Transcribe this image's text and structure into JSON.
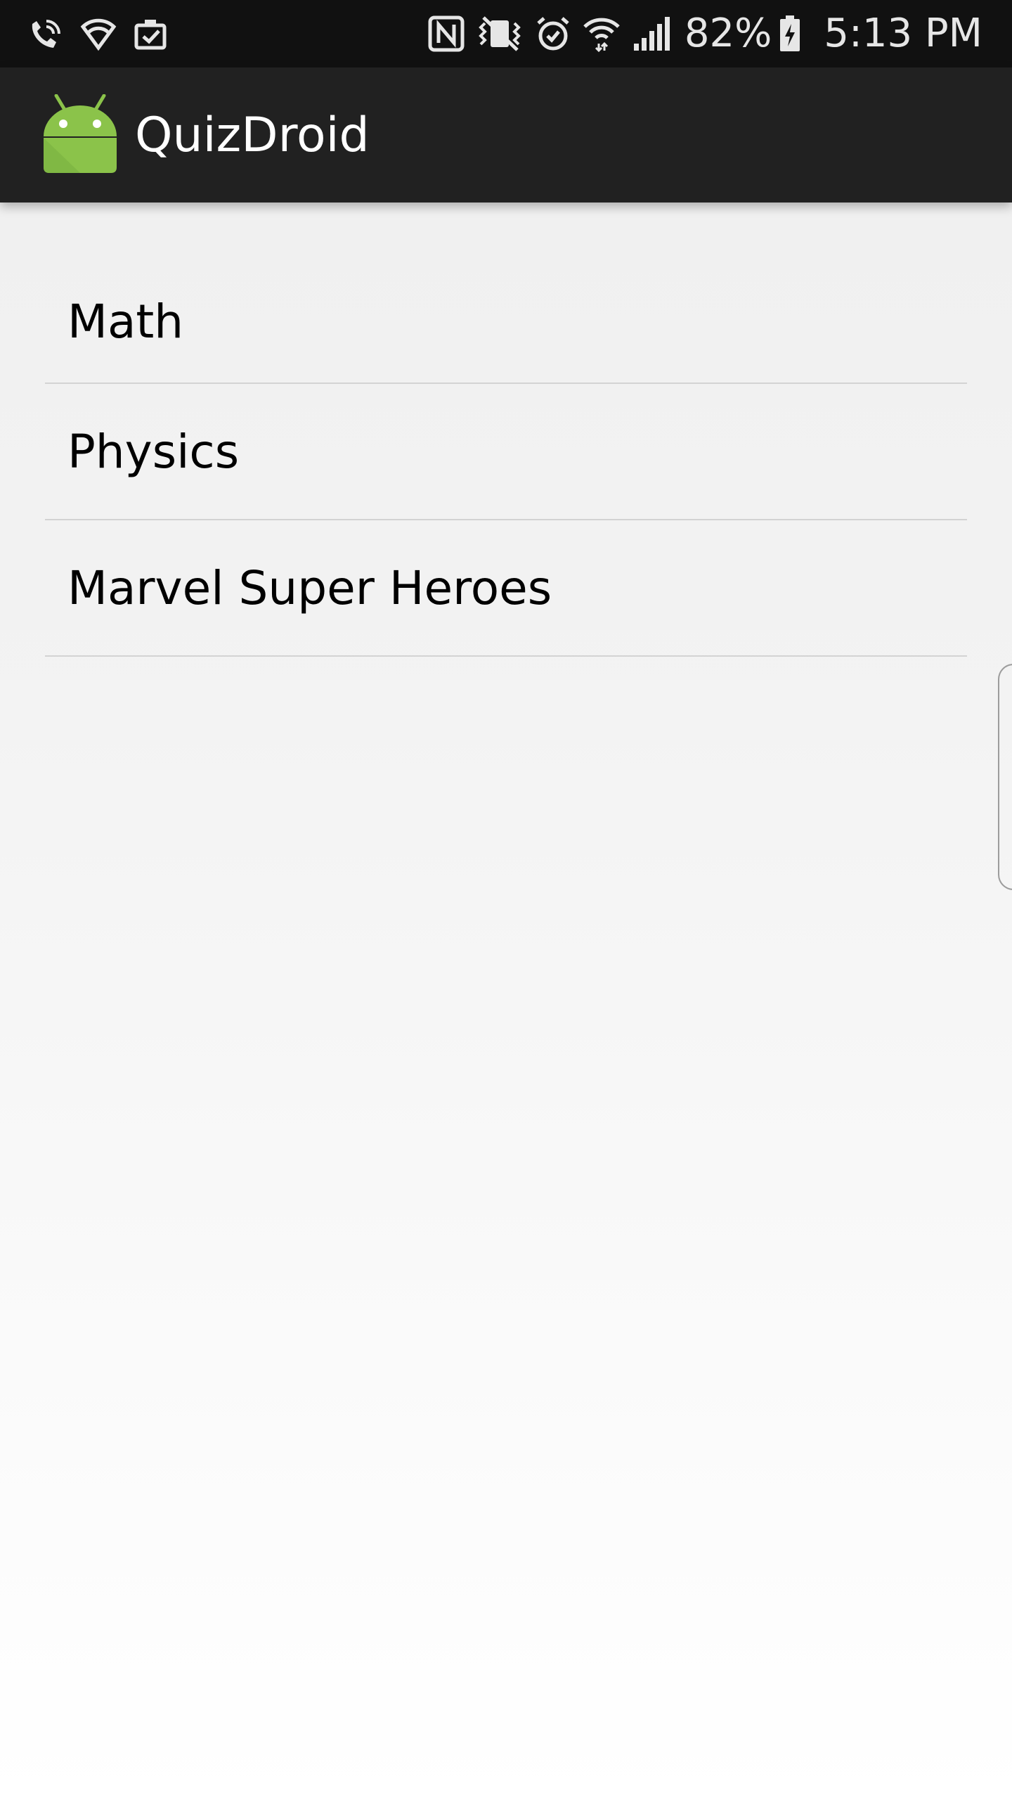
{
  "status_bar": {
    "left_icons": [
      "wifi-calling-icon",
      "wifi-secure-icon",
      "clipboard-check-icon"
    ],
    "right_icons": [
      "nfc-icon",
      "vibrate-icon",
      "alarm-icon",
      "wifi-icon",
      "signal-icon"
    ],
    "battery_percent": "82%",
    "battery_icon": "battery-charging-icon",
    "time": "5:13 PM"
  },
  "action_bar": {
    "logo_icon": "android-robot-icon",
    "title": "QuizDroid",
    "colors": {
      "background": "#212121",
      "logo": "#8BC34A"
    }
  },
  "topics": [
    {
      "label": "Math"
    },
    {
      "label": "Physics"
    },
    {
      "label": "Marvel Super Heroes"
    }
  ],
  "edge_panel": {
    "icon": "edge-handle"
  }
}
